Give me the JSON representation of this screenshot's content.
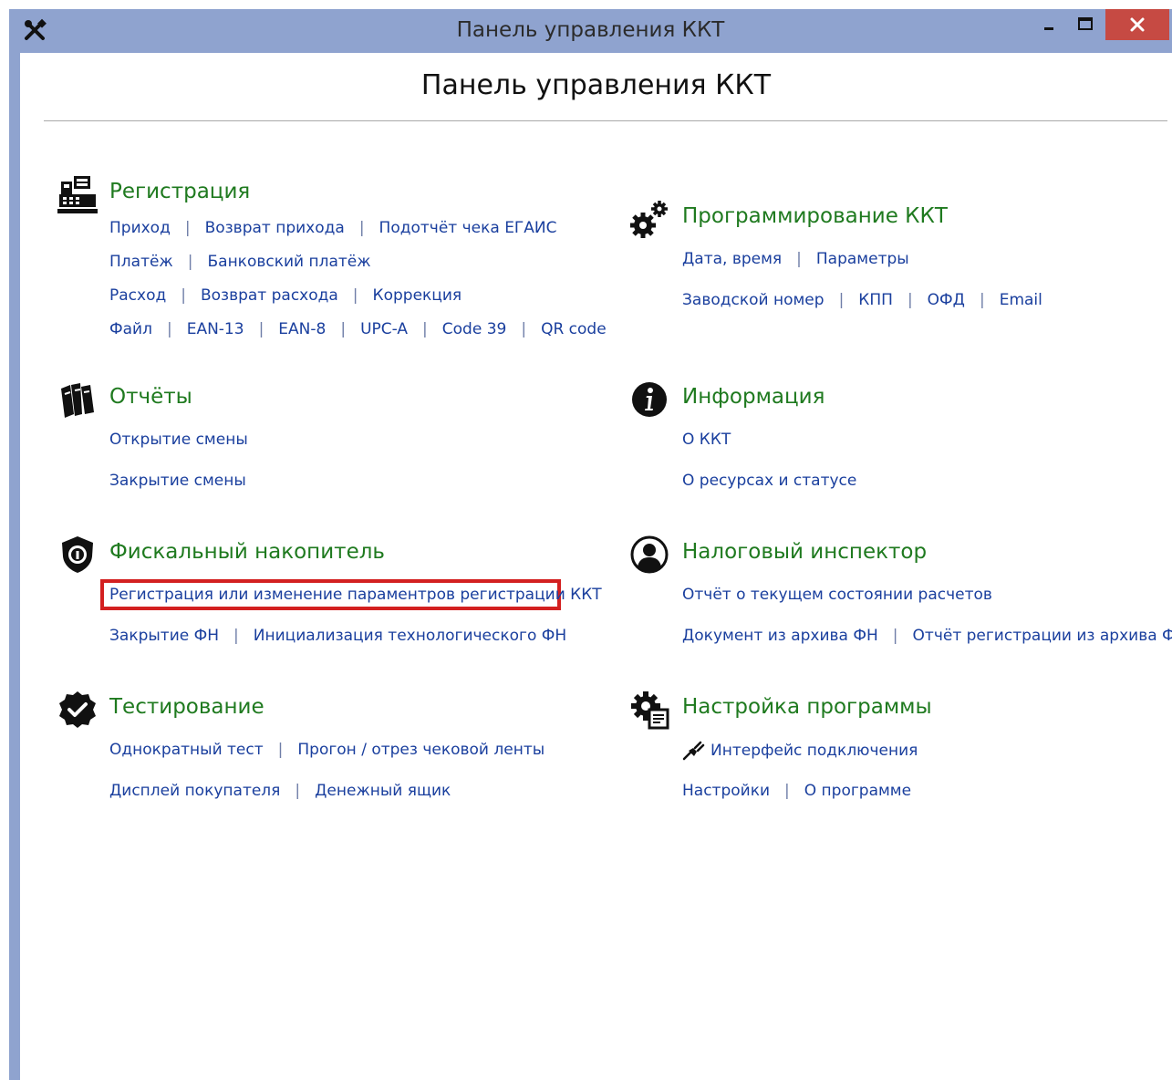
{
  "window": {
    "title": "Панель управления ККТ"
  },
  "header": {
    "title": "Панель управления ККТ"
  },
  "colors": {
    "titlebar": "#8fa3cf",
    "close": "#c64a43",
    "section_title": "#1f7a1f",
    "link": "#1a3f9e",
    "highlight": "#d32020"
  },
  "icons": {
    "app": "tools-icon",
    "registration": "cash-register-icon",
    "reports": "books-icon",
    "fiscal": "shield-icon",
    "testing": "check-badge-icon",
    "programming": "gears-icon",
    "information": "info-icon",
    "inspector": "user-circle-icon",
    "settings": "gear-document-icon",
    "plug": "plug-icon"
  },
  "sections": {
    "registration": {
      "title": "Регистрация",
      "rows": [
        [
          "Приход",
          "Возврат прихода",
          "Подотчёт чека ЕГАИС"
        ],
        [
          "Платёж",
          "Банковский платёж"
        ],
        [
          "Расход",
          "Возврат расхода",
          "Коррекция"
        ],
        [
          "Файл",
          "EAN-13",
          "EAN-8",
          "UPC-A",
          "Code 39",
          "QR code"
        ]
      ]
    },
    "reports": {
      "title": "Отчёты",
      "rows": [
        [
          "Открытие смены"
        ],
        [
          "Закрытие смены"
        ]
      ]
    },
    "fiscal": {
      "title": "Фискальный накопитель",
      "rows": [
        [
          "Регистрация или изменение параментров регистрации ККТ"
        ],
        [
          "Закрытие ФН",
          "Инициализация технологического ФН"
        ]
      ]
    },
    "testing": {
      "title": "Тестирование",
      "rows": [
        [
          "Однократный тест",
          "Прогон / отрез чековой ленты"
        ],
        [
          "Дисплей покупателя",
          "Денежный ящик"
        ]
      ]
    },
    "programming": {
      "title": "Программирование ККТ",
      "rows": [
        [
          "Дата, время",
          "Параметры"
        ],
        [
          "Заводской номер",
          "КПП",
          "ОФД",
          "Email"
        ]
      ]
    },
    "information": {
      "title": "Информация",
      "rows": [
        [
          "О ККТ"
        ],
        [
          "О ресурсах и статусе"
        ]
      ]
    },
    "inspector": {
      "title": "Налоговый инспектор",
      "rows": [
        [
          "Отчёт о текущем состоянии расчетов"
        ],
        [
          "Документ из архива ФН",
          "Отчёт регистрации из архива ФН"
        ]
      ]
    },
    "settings": {
      "title": "Настройка программы",
      "rows": [
        [
          "Интерфейс подключения"
        ],
        [
          "Настройки",
          "О программе"
        ]
      ]
    }
  },
  "separator": "|"
}
